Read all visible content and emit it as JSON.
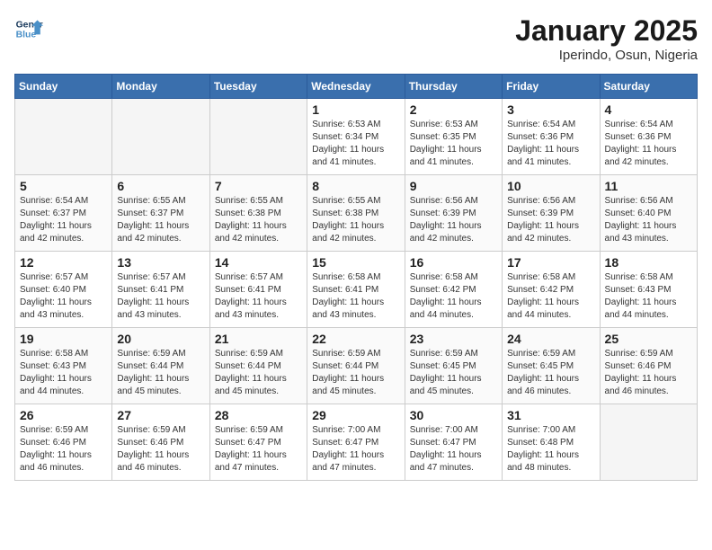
{
  "header": {
    "logo_line1": "General",
    "logo_line2": "Blue",
    "title": "January 2025",
    "subtitle": "Iperindo, Osun, Nigeria"
  },
  "days_of_week": [
    "Sunday",
    "Monday",
    "Tuesday",
    "Wednesday",
    "Thursday",
    "Friday",
    "Saturday"
  ],
  "weeks": [
    [
      {
        "day": "",
        "info": ""
      },
      {
        "day": "",
        "info": ""
      },
      {
        "day": "",
        "info": ""
      },
      {
        "day": "1",
        "info": "Sunrise: 6:53 AM\nSunset: 6:34 PM\nDaylight: 11 hours\nand 41 minutes."
      },
      {
        "day": "2",
        "info": "Sunrise: 6:53 AM\nSunset: 6:35 PM\nDaylight: 11 hours\nand 41 minutes."
      },
      {
        "day": "3",
        "info": "Sunrise: 6:54 AM\nSunset: 6:36 PM\nDaylight: 11 hours\nand 41 minutes."
      },
      {
        "day": "4",
        "info": "Sunrise: 6:54 AM\nSunset: 6:36 PM\nDaylight: 11 hours\nand 42 minutes."
      }
    ],
    [
      {
        "day": "5",
        "info": "Sunrise: 6:54 AM\nSunset: 6:37 PM\nDaylight: 11 hours\nand 42 minutes."
      },
      {
        "day": "6",
        "info": "Sunrise: 6:55 AM\nSunset: 6:37 PM\nDaylight: 11 hours\nand 42 minutes."
      },
      {
        "day": "7",
        "info": "Sunrise: 6:55 AM\nSunset: 6:38 PM\nDaylight: 11 hours\nand 42 minutes."
      },
      {
        "day": "8",
        "info": "Sunrise: 6:55 AM\nSunset: 6:38 PM\nDaylight: 11 hours\nand 42 minutes."
      },
      {
        "day": "9",
        "info": "Sunrise: 6:56 AM\nSunset: 6:39 PM\nDaylight: 11 hours\nand 42 minutes."
      },
      {
        "day": "10",
        "info": "Sunrise: 6:56 AM\nSunset: 6:39 PM\nDaylight: 11 hours\nand 42 minutes."
      },
      {
        "day": "11",
        "info": "Sunrise: 6:56 AM\nSunset: 6:40 PM\nDaylight: 11 hours\nand 43 minutes."
      }
    ],
    [
      {
        "day": "12",
        "info": "Sunrise: 6:57 AM\nSunset: 6:40 PM\nDaylight: 11 hours\nand 43 minutes."
      },
      {
        "day": "13",
        "info": "Sunrise: 6:57 AM\nSunset: 6:41 PM\nDaylight: 11 hours\nand 43 minutes."
      },
      {
        "day": "14",
        "info": "Sunrise: 6:57 AM\nSunset: 6:41 PM\nDaylight: 11 hours\nand 43 minutes."
      },
      {
        "day": "15",
        "info": "Sunrise: 6:58 AM\nSunset: 6:41 PM\nDaylight: 11 hours\nand 43 minutes."
      },
      {
        "day": "16",
        "info": "Sunrise: 6:58 AM\nSunset: 6:42 PM\nDaylight: 11 hours\nand 44 minutes."
      },
      {
        "day": "17",
        "info": "Sunrise: 6:58 AM\nSunset: 6:42 PM\nDaylight: 11 hours\nand 44 minutes."
      },
      {
        "day": "18",
        "info": "Sunrise: 6:58 AM\nSunset: 6:43 PM\nDaylight: 11 hours\nand 44 minutes."
      }
    ],
    [
      {
        "day": "19",
        "info": "Sunrise: 6:58 AM\nSunset: 6:43 PM\nDaylight: 11 hours\nand 44 minutes."
      },
      {
        "day": "20",
        "info": "Sunrise: 6:59 AM\nSunset: 6:44 PM\nDaylight: 11 hours\nand 45 minutes."
      },
      {
        "day": "21",
        "info": "Sunrise: 6:59 AM\nSunset: 6:44 PM\nDaylight: 11 hours\nand 45 minutes."
      },
      {
        "day": "22",
        "info": "Sunrise: 6:59 AM\nSunset: 6:44 PM\nDaylight: 11 hours\nand 45 minutes."
      },
      {
        "day": "23",
        "info": "Sunrise: 6:59 AM\nSunset: 6:45 PM\nDaylight: 11 hours\nand 45 minutes."
      },
      {
        "day": "24",
        "info": "Sunrise: 6:59 AM\nSunset: 6:45 PM\nDaylight: 11 hours\nand 46 minutes."
      },
      {
        "day": "25",
        "info": "Sunrise: 6:59 AM\nSunset: 6:46 PM\nDaylight: 11 hours\nand 46 minutes."
      }
    ],
    [
      {
        "day": "26",
        "info": "Sunrise: 6:59 AM\nSunset: 6:46 PM\nDaylight: 11 hours\nand 46 minutes."
      },
      {
        "day": "27",
        "info": "Sunrise: 6:59 AM\nSunset: 6:46 PM\nDaylight: 11 hours\nand 46 minutes."
      },
      {
        "day": "28",
        "info": "Sunrise: 6:59 AM\nSunset: 6:47 PM\nDaylight: 11 hours\nand 47 minutes."
      },
      {
        "day": "29",
        "info": "Sunrise: 7:00 AM\nSunset: 6:47 PM\nDaylight: 11 hours\nand 47 minutes."
      },
      {
        "day": "30",
        "info": "Sunrise: 7:00 AM\nSunset: 6:47 PM\nDaylight: 11 hours\nand 47 minutes."
      },
      {
        "day": "31",
        "info": "Sunrise: 7:00 AM\nSunset: 6:48 PM\nDaylight: 11 hours\nand 48 minutes."
      },
      {
        "day": "",
        "info": ""
      }
    ]
  ]
}
